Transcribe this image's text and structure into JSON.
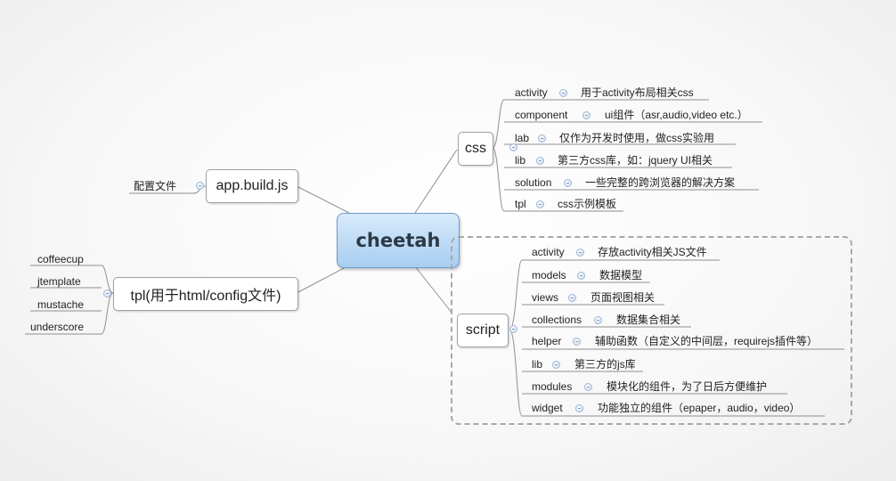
{
  "root": {
    "label": "cheetah"
  },
  "left": {
    "appbuild": {
      "label": "app.build.js",
      "children": [
        "配置文件"
      ]
    },
    "tpl": {
      "label": "tpl(用于html/config文件)",
      "children": [
        "coffeecup",
        "jtemplate",
        "mustache",
        "underscore"
      ]
    }
  },
  "css": {
    "label": "css",
    "items": [
      {
        "name": "activity",
        "desc": "用于activity布局相关css"
      },
      {
        "name": "component",
        "desc": "ui组件（asr,audio,video etc.）"
      },
      {
        "name": "lab",
        "desc": "仅作为开发时使用，做css实验用"
      },
      {
        "name": "lib",
        "desc": "第三方css库，如：jquery UI相关"
      },
      {
        "name": "solution",
        "desc": "一些完整的跨浏览器的解决方案"
      },
      {
        "name": "tpl",
        "desc": "css示例模板"
      }
    ]
  },
  "script": {
    "label": "script",
    "items": [
      {
        "name": "activity",
        "desc": "存放activity相关JS文件"
      },
      {
        "name": "models",
        "desc": "数据模型"
      },
      {
        "name": "views",
        "desc": "页面视图相关"
      },
      {
        "name": "collections",
        "desc": "数据集合相关"
      },
      {
        "name": "helper",
        "desc": "辅助函数（自定义的中间层，requirejs插件等）"
      },
      {
        "name": "lib",
        "desc": "第三方的js库"
      },
      {
        "name": "modules",
        "desc": "模块化的组件，为了日后方便维护"
      },
      {
        "name": "widget",
        "desc": "功能独立的组件（epaper，audio，video）"
      }
    ]
  }
}
